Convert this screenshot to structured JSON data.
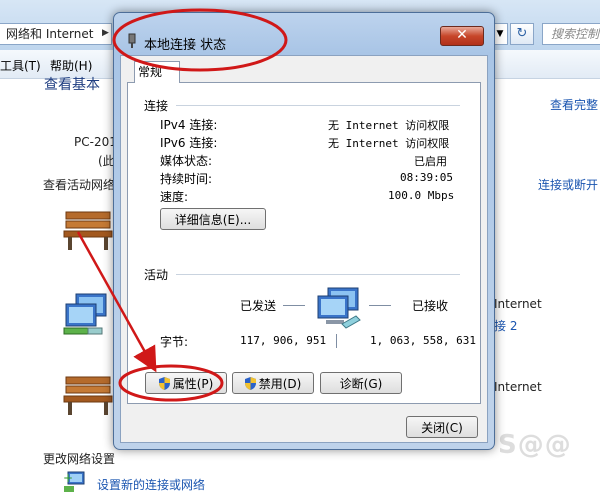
{
  "background": {
    "address_text": "网络和 Internet",
    "search_placeholder": "搜索控制",
    "menu": [
      "工具(T)",
      "帮助(H)"
    ],
    "heading_partial": "查看基本",
    "computer_name": "PC-201",
    "computer_sub": "(此",
    "active_networks_label": "查看活动网络",
    "view_full_map": "查看完整",
    "connect_disconnect": "连接或断开",
    "access_type_1": "Internet",
    "connection_link_1": "接 2",
    "access_type_2": "Internet",
    "change_settings_heading": "更改网络设置",
    "setup_new_connection": "设置新的连接或网络",
    "watermark": "S@@"
  },
  "dialog": {
    "title": "本地连接 状态",
    "close_symbol": "✕",
    "tab_label": "常规",
    "connection": {
      "section_label": "连接",
      "rows": [
        {
          "label": "IPv4 连接:",
          "value": "无 Internet 访问权限"
        },
        {
          "label": "IPv6 连接:",
          "value": "无 Internet 访问权限"
        },
        {
          "label": "媒体状态:",
          "value": "已启用"
        },
        {
          "label": "持续时间:",
          "value": "08:39:05"
        },
        {
          "label": "速度:",
          "value": "100.0 Mbps"
        }
      ],
      "details_button": "详细信息(E)..."
    },
    "activity": {
      "section_label": "活动",
      "sent_label": "已发送",
      "received_label": "已接收",
      "bytes_label": "字节:",
      "bytes_sent": "117, 906, 951",
      "bytes_received": "1, 063, 558, 631"
    },
    "buttons": {
      "properties": "属性(P)",
      "disable": "禁用(D)",
      "diagnose": "诊断(G)",
      "close": "关闭(C)"
    }
  },
  "colors": {
    "annotation_red": "#d01818",
    "link_blue": "#1a55b0",
    "title_bar": "#bdd3ed"
  },
  "icons": [
    "network-adapter-icon",
    "bench-icon",
    "shield-icon",
    "network-computers-icon",
    "close-icon",
    "add-network-icon"
  ]
}
